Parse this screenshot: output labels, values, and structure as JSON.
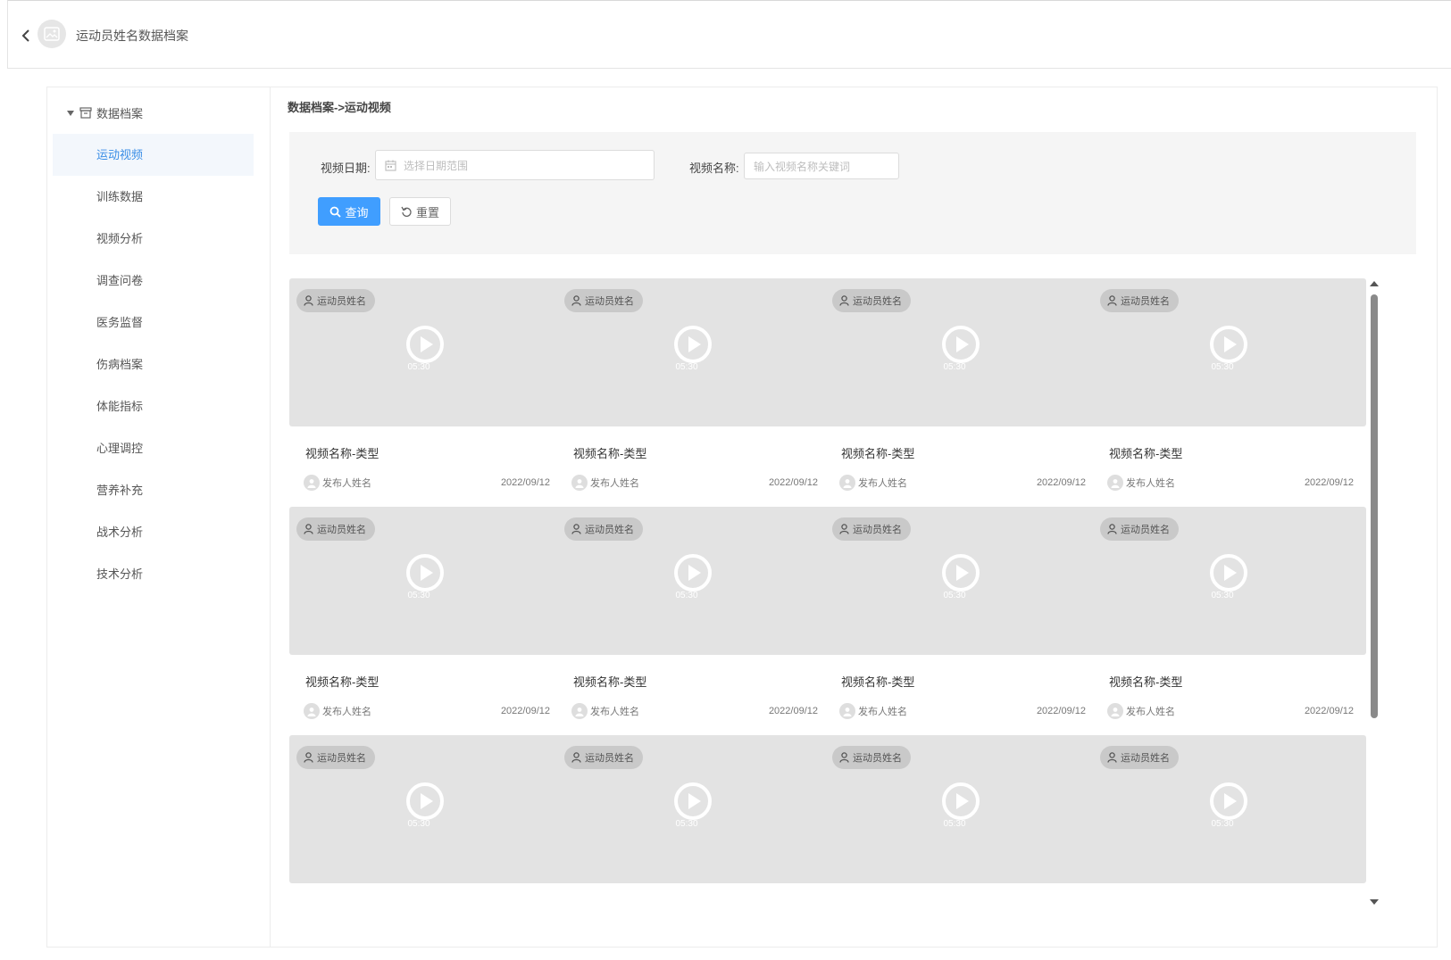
{
  "header": {
    "title": "运动员姓名数据档案"
  },
  "sidebar": {
    "root_label": "数据档案",
    "items": [
      {
        "label": "运动视频",
        "active": true
      },
      {
        "label": "训练数据"
      },
      {
        "label": "视频分析"
      },
      {
        "label": "调查问卷"
      },
      {
        "label": "医务监督"
      },
      {
        "label": "伤病档案"
      },
      {
        "label": "体能指标"
      },
      {
        "label": "心理调控"
      },
      {
        "label": "营养补充"
      },
      {
        "label": "战术分析"
      },
      {
        "label": "技术分析"
      }
    ]
  },
  "breadcrumb": "数据档案->运动视频",
  "filter": {
    "date_label": "视频日期:",
    "date_placeholder": "选择日期范围",
    "name_label": "视频名称:",
    "name_placeholder": "输入视频名称关键词",
    "search_label": "查询",
    "reset_label": "重置"
  },
  "videos": [
    {
      "athlete": "运动员姓名",
      "duration": "05:30",
      "title": "视频名称-类型",
      "publisher": "发布人姓名",
      "date": "2022/09/12"
    },
    {
      "athlete": "运动员姓名",
      "duration": "05:30",
      "title": "视频名称-类型",
      "publisher": "发布人姓名",
      "date": "2022/09/12"
    },
    {
      "athlete": "运动员姓名",
      "duration": "05:30",
      "title": "视频名称-类型",
      "publisher": "发布人姓名",
      "date": "2022/09/12"
    },
    {
      "athlete": "运动员姓名",
      "duration": "05:30",
      "title": "视频名称-类型",
      "publisher": "发布人姓名",
      "date": "2022/09/12"
    },
    {
      "athlete": "运动员姓名",
      "duration": "05:30",
      "title": "视频名称-类型",
      "publisher": "发布人姓名",
      "date": "2022/09/12"
    },
    {
      "athlete": "运动员姓名",
      "duration": "05:30",
      "title": "视频名称-类型",
      "publisher": "发布人姓名",
      "date": "2022/09/12"
    },
    {
      "athlete": "运动员姓名",
      "duration": "05:30",
      "title": "视频名称-类型",
      "publisher": "发布人姓名",
      "date": "2022/09/12"
    },
    {
      "athlete": "运动员姓名",
      "duration": "05:30",
      "title": "视频名称-类型",
      "publisher": "发布人姓名",
      "date": "2022/09/12"
    },
    {
      "athlete": "运动员姓名",
      "duration": "05:30"
    },
    {
      "athlete": "运动员姓名",
      "duration": "05:30"
    },
    {
      "athlete": "运动员姓名",
      "duration": "05:30"
    },
    {
      "athlete": "运动员姓名",
      "duration": "05:30"
    }
  ],
  "colors": {
    "accent": "#409eff",
    "active_menu_text": "#3a8ee6",
    "active_menu_bg": "#f3f7fc",
    "thumb_bg": "#e3e3e3"
  }
}
